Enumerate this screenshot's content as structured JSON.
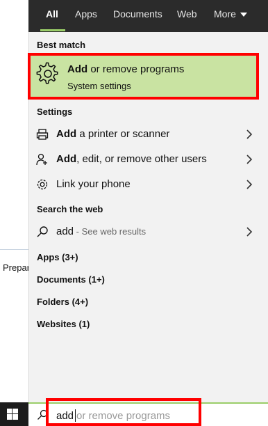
{
  "background": {
    "partial_text": "Prepar"
  },
  "tabs": [
    {
      "label": "All",
      "active": true
    },
    {
      "label": "Apps"
    },
    {
      "label": "Documents"
    },
    {
      "label": "Web"
    },
    {
      "label": "More"
    }
  ],
  "best_match": {
    "section_label": "Best match",
    "title_bold": "Add",
    "title_rest": " or remove programs",
    "subtitle": "System settings",
    "icon": "gear-icon",
    "highlight_color": "#c9e3a2"
  },
  "settings": {
    "section_label": "Settings",
    "items": [
      {
        "bold": "Add",
        "rest": " a printer or scanner",
        "icon": "printer-icon"
      },
      {
        "bold": "Add",
        "rest": ", edit, or remove other users",
        "icon": "person-add-icon"
      },
      {
        "bold": "",
        "rest": "Link your phone",
        "icon": "gear-icon"
      }
    ]
  },
  "web": {
    "section_label": "Search the web",
    "query": "add",
    "suffix": " - See web results"
  },
  "categories": [
    "Apps (3+)",
    "Documents (1+)",
    "Folders (4+)",
    "Websites (1)"
  ],
  "search": {
    "typed": "add",
    "ghost": " or remove programs"
  },
  "colors": {
    "accent": "#9acd68",
    "annotation": "#ff0000",
    "tabbar": "#2b2b2b"
  }
}
